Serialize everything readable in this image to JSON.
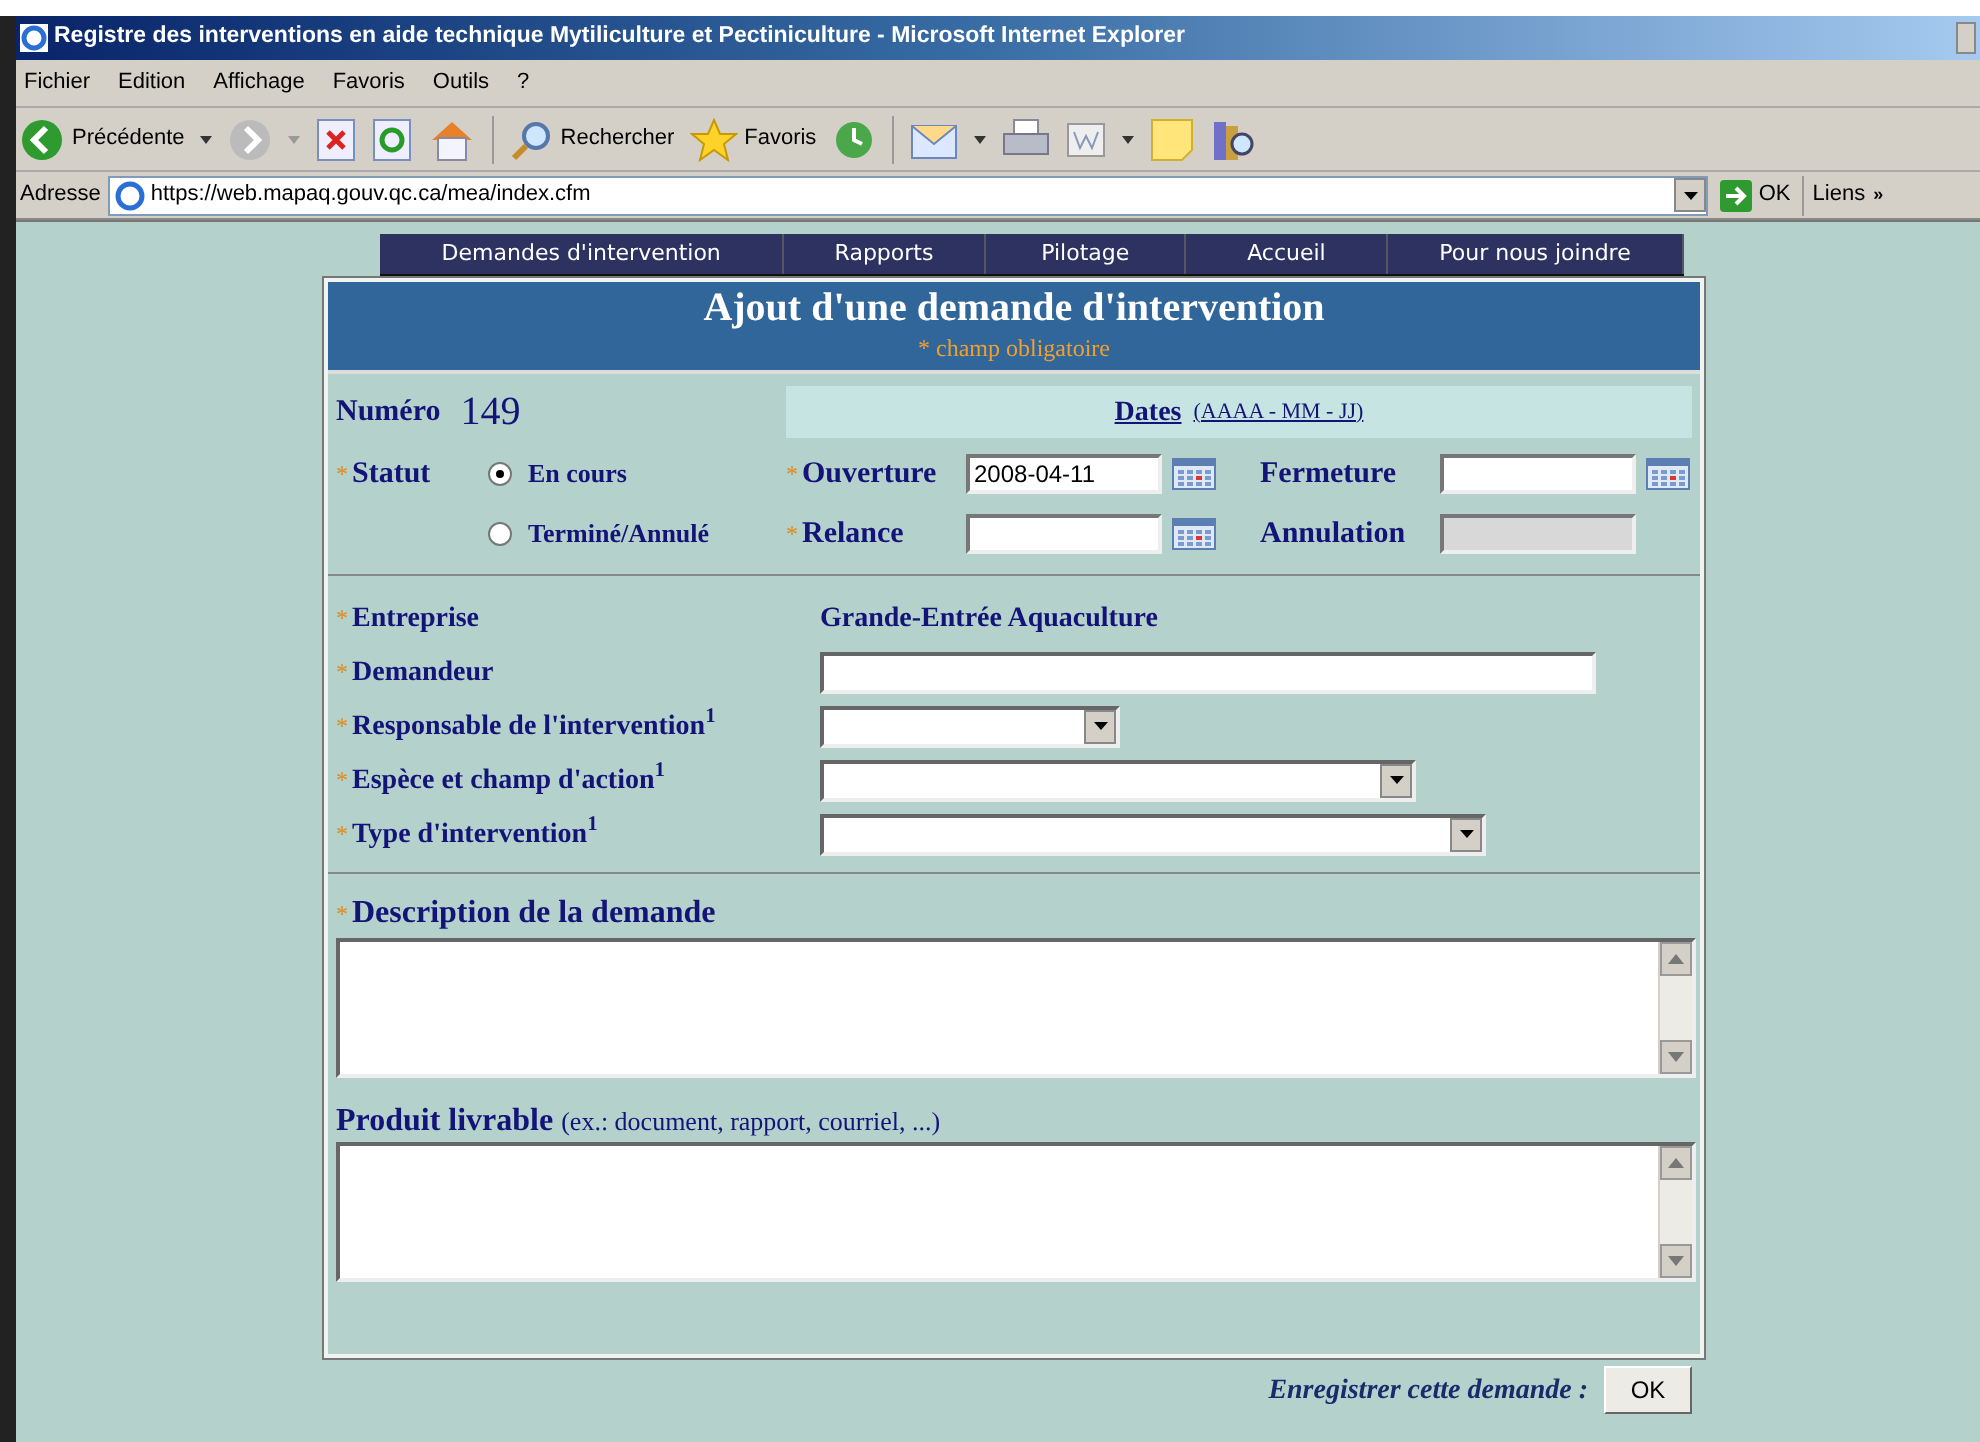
{
  "window": {
    "title": "Registre des interventions en aide technique Mytiliculture et Pectiniculture - Microsoft Internet Explorer"
  },
  "menu": [
    "Fichier",
    "Edition",
    "Affichage",
    "Favoris",
    "Outils",
    "?"
  ],
  "toolbar": {
    "back": "Précédente",
    "search": "Rechercher",
    "favorites": "Favoris"
  },
  "address": {
    "label": "Adresse",
    "url": "https://web.mapaq.gouv.qc.ca/mea/index.cfm",
    "go": "OK",
    "links": "Liens",
    "chevron": "»"
  },
  "nav": [
    "Demandes d'intervention",
    "Rapports",
    "Pilotage",
    "Accueil",
    "Pour nous joindre"
  ],
  "form": {
    "title": "Ajout d'une demande d'intervention",
    "note": "* champ obligatoire",
    "numero_label": "Numéro",
    "numero": "149",
    "dates_label": "Dates",
    "dates_format": "(AAAA - MM - JJ)",
    "statut": {
      "mark": "*",
      "label": "Statut"
    },
    "radios": [
      {
        "label": "En cours",
        "selected": true
      },
      {
        "label": "Terminé/Annulé",
        "selected": false
      }
    ],
    "dates": [
      {
        "mark": "*",
        "label": "Ouverture",
        "value": "2008-04-11",
        "disabled": false
      },
      {
        "label": "Fermeture",
        "disabled": false
      },
      {
        "mark": "*",
        "label": "Relance",
        "disabled": false
      },
      {
        "label": "Annulation",
        "disabled": true
      }
    ],
    "fields": [
      {
        "mark": "*",
        "label": "Entreprise",
        "kind": "static",
        "value": "Grande-Entrée Aquaculture"
      },
      {
        "mark": "*",
        "label": "Demandeur",
        "kind": "text"
      },
      {
        "mark": "*",
        "label": "Responsable de l'intervention$^{1}$",
        "kind": "select"
      },
      {
        "mark": "*",
        "label": "Espèce et champ d'action$^{1}$",
        "kind": "select"
      },
      {
        "mark": "*",
        "label": "Type d'intervention$^{1}$",
        "kind": "select"
      }
    ],
    "description": {
      "mark": "*",
      "label": "Description de la demande"
    },
    "produit": {
      "label": "Produit livrable",
      "hint": "(ex.: document, rapport, courriel, ...)"
    },
    "save_label": "Enregistrer cette demande :",
    "save_button": "OK"
  }
}
